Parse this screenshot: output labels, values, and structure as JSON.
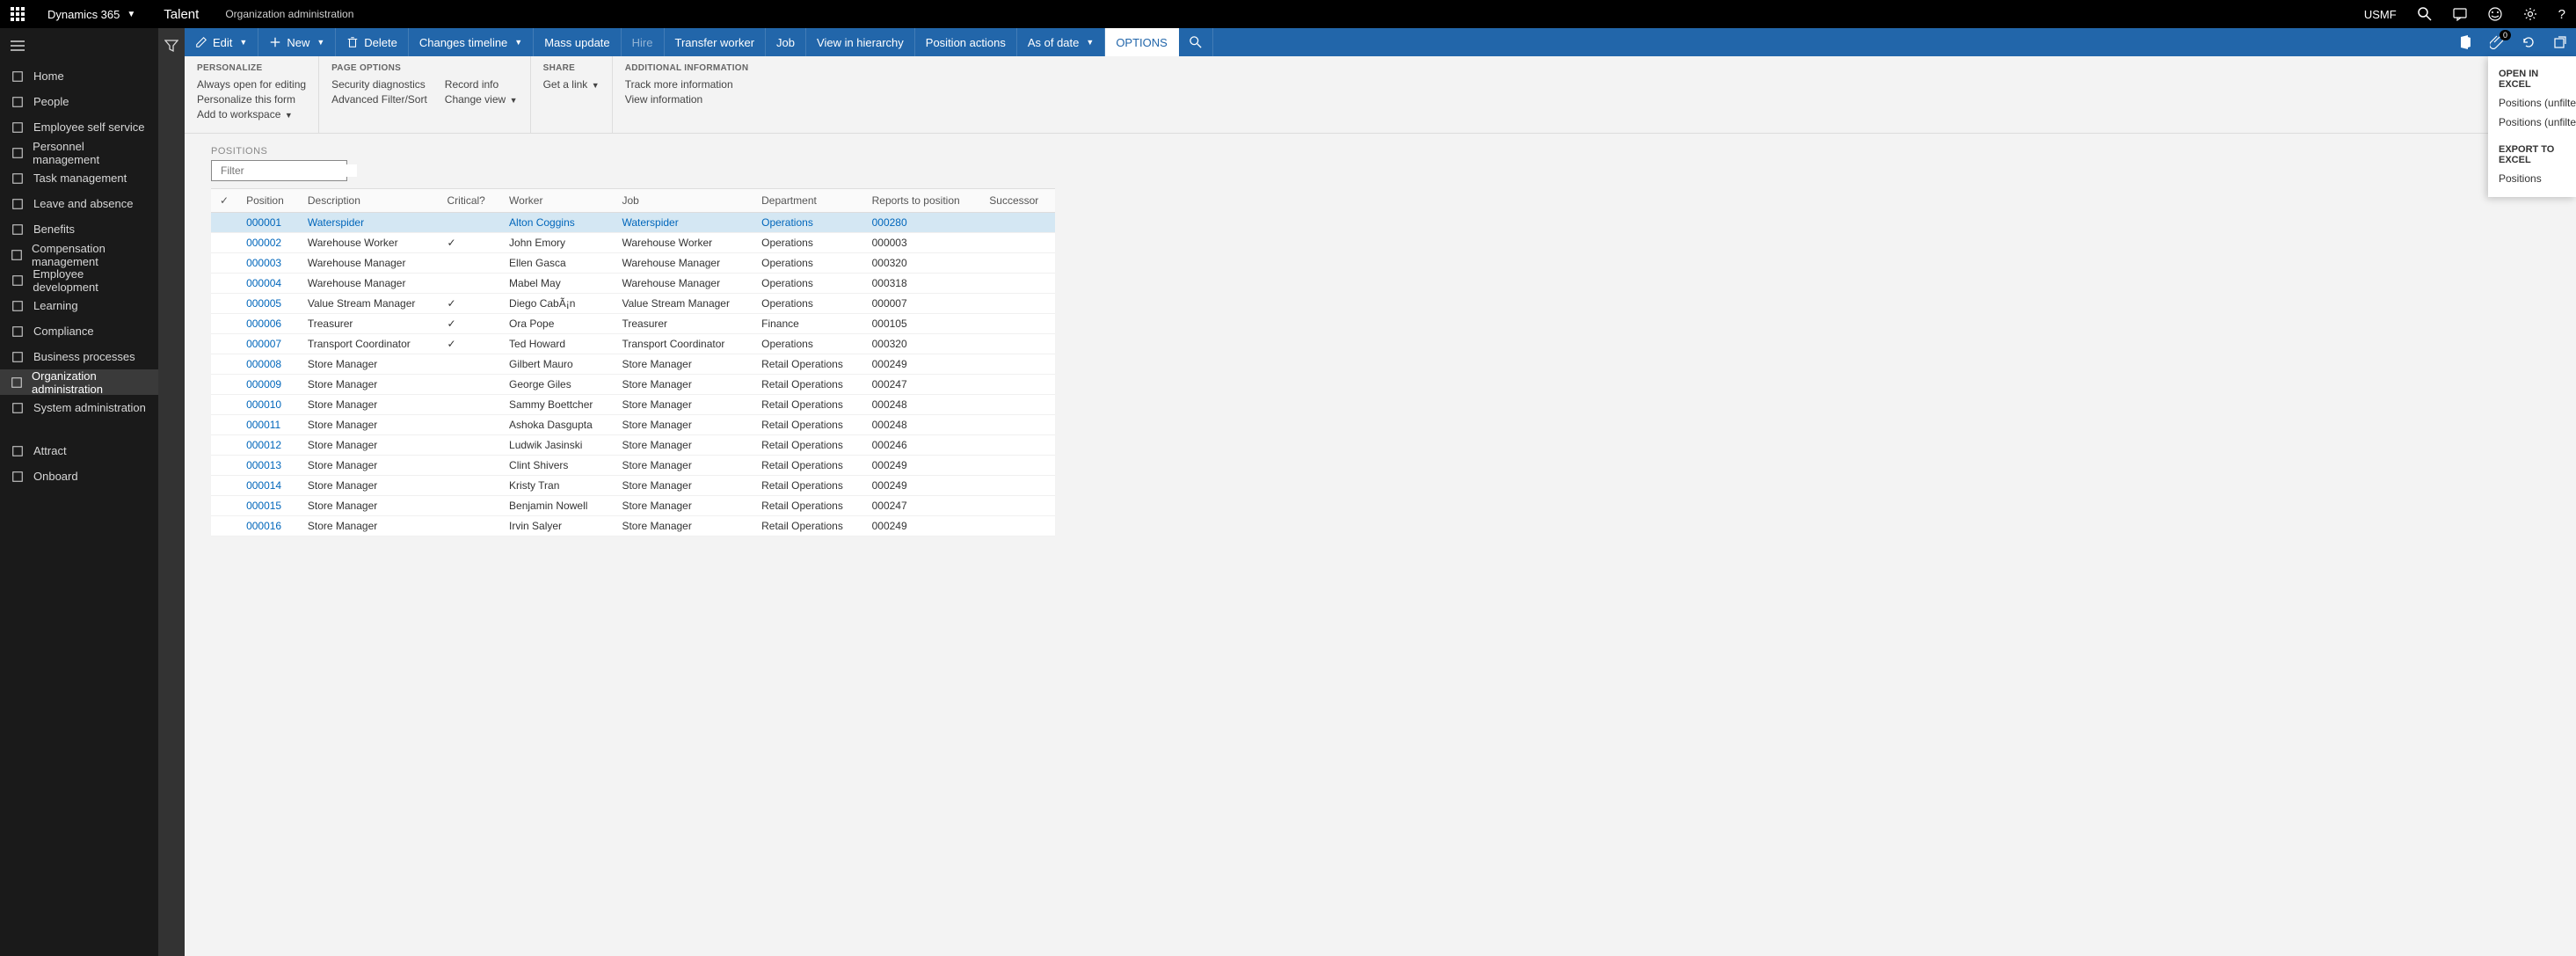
{
  "topbar": {
    "brand": "Dynamics 365",
    "product": "Talent",
    "breadcrumb": "Organization administration",
    "company": "USMF"
  },
  "leftnav": {
    "items": [
      {
        "label": "Home",
        "icon": "home"
      },
      {
        "label": "People",
        "icon": "people"
      },
      {
        "label": "Employee self service",
        "icon": "self"
      },
      {
        "label": "Personnel management",
        "icon": "personnel"
      },
      {
        "label": "Task management",
        "icon": "task"
      },
      {
        "label": "Leave and absence",
        "icon": "leave"
      },
      {
        "label": "Benefits",
        "icon": "benefits"
      },
      {
        "label": "Compensation management",
        "icon": "comp"
      },
      {
        "label": "Employee development",
        "icon": "dev"
      },
      {
        "label": "Learning",
        "icon": "learn"
      },
      {
        "label": "Compliance",
        "icon": "compliance"
      },
      {
        "label": "Business processes",
        "icon": "process"
      },
      {
        "label": "Organization administration",
        "icon": "org",
        "active": true
      },
      {
        "label": "System administration",
        "icon": "sys"
      }
    ],
    "bottom": [
      {
        "label": "Attract",
        "icon": "attract"
      },
      {
        "label": "Onboard",
        "icon": "onboard"
      }
    ]
  },
  "actionbar": {
    "edit": "Edit",
    "new": "New",
    "delete": "Delete",
    "changes_timeline": "Changes timeline",
    "mass_update": "Mass update",
    "hire": "Hire",
    "transfer": "Transfer worker",
    "job": "Job",
    "view_hierarchy": "View in hierarchy",
    "position_actions": "Position actions",
    "as_of_date": "As of date",
    "options": "OPTIONS",
    "notif_count": "0"
  },
  "ribbon": {
    "personalize": {
      "title": "PERSONALIZE",
      "always_open": "Always open for editing",
      "personalize_form": "Personalize this form",
      "add_workspace": "Add to workspace"
    },
    "page_options": {
      "title": "PAGE OPTIONS",
      "security": "Security diagnostics",
      "adv_filter": "Advanced Filter/Sort",
      "record_info": "Record info",
      "change_view": "Change view"
    },
    "share": {
      "title": "SHARE",
      "get_link": "Get a link"
    },
    "additional": {
      "title": "ADDITIONAL INFORMATION",
      "track_more": "Track more information",
      "view_info": "View information"
    }
  },
  "grid": {
    "title": "POSITIONS",
    "filter_placeholder": "Filter",
    "columns": {
      "position": "Position",
      "description": "Description",
      "critical": "Critical?",
      "worker": "Worker",
      "job": "Job",
      "department": "Department",
      "reports_to": "Reports to position",
      "successor": "Successor"
    },
    "rows": [
      {
        "pos": "000001",
        "desc": "Waterspider",
        "crit": false,
        "worker": "Alton Coggins",
        "job": "Waterspider",
        "dept": "Operations",
        "reports": "000280",
        "selected": true
      },
      {
        "pos": "000002",
        "desc": "Warehouse Worker",
        "crit": true,
        "worker": "John Emory",
        "job": "Warehouse Worker",
        "dept": "Operations",
        "reports": "000003"
      },
      {
        "pos": "000003",
        "desc": "Warehouse Manager",
        "crit": false,
        "worker": "Ellen Gasca",
        "job": "Warehouse Manager",
        "dept": "Operations",
        "reports": "000320"
      },
      {
        "pos": "000004",
        "desc": "Warehouse Manager",
        "crit": false,
        "worker": "Mabel May",
        "job": "Warehouse Manager",
        "dept": "Operations",
        "reports": "000318"
      },
      {
        "pos": "000005",
        "desc": "Value Stream Manager",
        "crit": true,
        "worker": "Diego CabÃ¡n",
        "job": "Value Stream Manager",
        "dept": "Operations",
        "reports": "000007"
      },
      {
        "pos": "000006",
        "desc": "Treasurer",
        "crit": true,
        "worker": "Ora Pope",
        "job": "Treasurer",
        "dept": "Finance",
        "reports": "000105"
      },
      {
        "pos": "000007",
        "desc": "Transport Coordinator",
        "crit": true,
        "worker": "Ted Howard",
        "job": "Transport Coordinator",
        "dept": "Operations",
        "reports": "000320"
      },
      {
        "pos": "000008",
        "desc": "Store Manager",
        "crit": false,
        "worker": "Gilbert Mauro",
        "job": "Store Manager",
        "dept": "Retail Operations",
        "reports": "000249"
      },
      {
        "pos": "000009",
        "desc": "Store Manager",
        "crit": false,
        "worker": "George Giles",
        "job": "Store Manager",
        "dept": "Retail Operations",
        "reports": "000247"
      },
      {
        "pos": "000010",
        "desc": "Store Manager",
        "crit": false,
        "worker": "Sammy Boettcher",
        "job": "Store Manager",
        "dept": "Retail Operations",
        "reports": "000248"
      },
      {
        "pos": "000011",
        "desc": "Store Manager",
        "crit": false,
        "worker": "Ashoka Dasgupta",
        "job": "Store Manager",
        "dept": "Retail Operations",
        "reports": "000248"
      },
      {
        "pos": "000012",
        "desc": "Store Manager",
        "crit": false,
        "worker": "Ludwik Jasinski",
        "job": "Store Manager",
        "dept": "Retail Operations",
        "reports": "000246"
      },
      {
        "pos": "000013",
        "desc": "Store Manager",
        "crit": false,
        "worker": "Clint Shivers",
        "job": "Store Manager",
        "dept": "Retail Operations",
        "reports": "000249"
      },
      {
        "pos": "000014",
        "desc": "Store Manager",
        "crit": false,
        "worker": "Kristy Tran",
        "job": "Store Manager",
        "dept": "Retail Operations",
        "reports": "000249"
      },
      {
        "pos": "000015",
        "desc": "Store Manager",
        "crit": false,
        "worker": "Benjamin Nowell",
        "job": "Store Manager",
        "dept": "Retail Operations",
        "reports": "000247"
      },
      {
        "pos": "000016",
        "desc": "Store Manager",
        "crit": false,
        "worker": "Irvin Salyer",
        "job": "Store Manager",
        "dept": "Retail Operations",
        "reports": "000249"
      }
    ]
  },
  "dropdown": {
    "open_excel_title": "OPEN IN EXCEL",
    "open_item1": "Positions (unfiltered)",
    "open_item2": "Positions (unfiltered)",
    "export_title": "EXPORT TO EXCEL",
    "export_item1": "Positions"
  }
}
